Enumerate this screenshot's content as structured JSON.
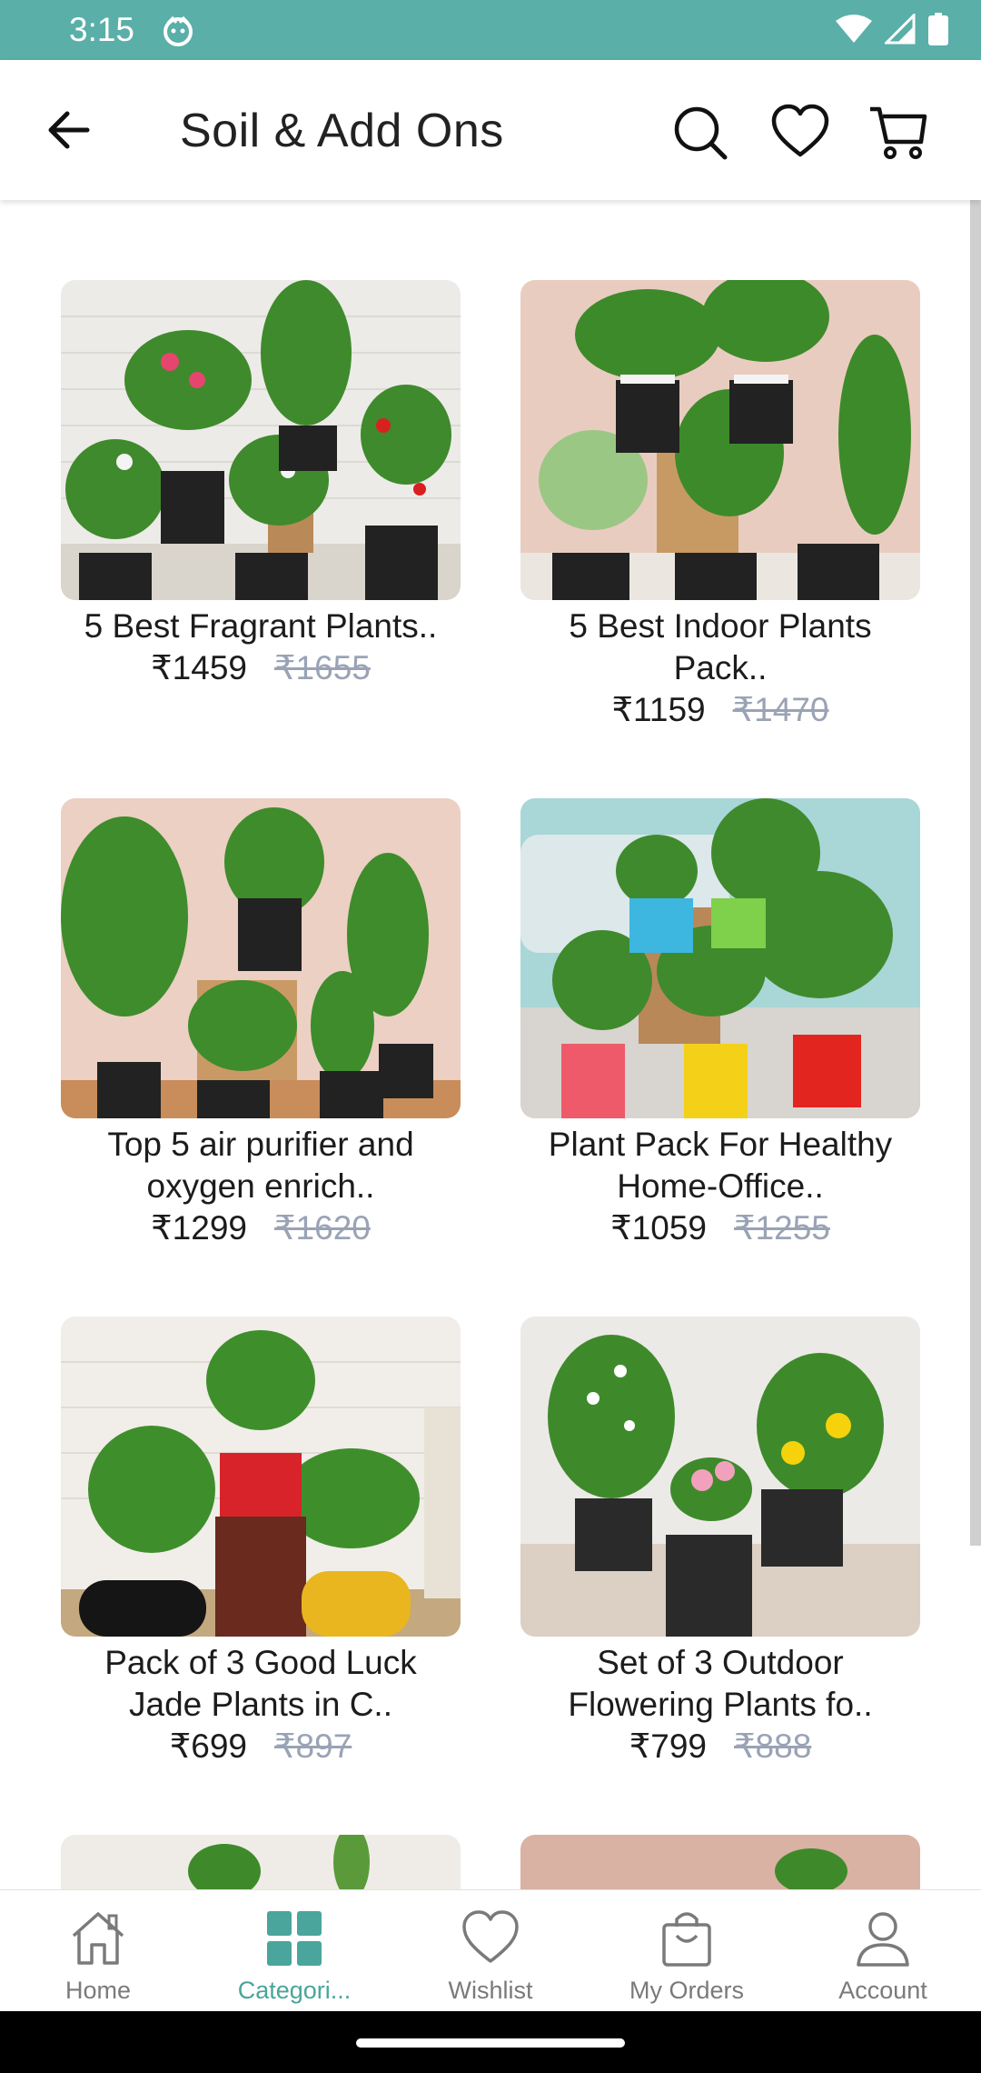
{
  "status_bar": {
    "time": "3:15"
  },
  "header": {
    "title": "Soil & Add Ons"
  },
  "products": [
    {
      "name": "5 Best Fragrant Plants..",
      "price": "₹1459",
      "mrp": "₹1655"
    },
    {
      "name": "5 Best Indoor Plants Pack..",
      "price": "₹1159",
      "mrp": "₹1470"
    },
    {
      "name": "Top 5 air purifier and oxygen enrich..",
      "price": "₹1299",
      "mrp": "₹1620"
    },
    {
      "name": "Plant Pack For Healthy Home-Office..",
      "price": "₹1059",
      "mrp": "₹1255"
    },
    {
      "name": "Pack of 3 Good Luck Jade Plants in C..",
      "price": "₹699",
      "mrp": "₹897"
    },
    {
      "name": "Set of 3 Outdoor Flowering Plants fo..",
      "price": "₹799",
      "mrp": "₹888"
    }
  ],
  "bottom_nav": [
    {
      "label": "Home",
      "icon": "home-icon",
      "active": false
    },
    {
      "label": "Categori...",
      "icon": "categories-icon",
      "active": true
    },
    {
      "label": "Wishlist",
      "icon": "heart-icon",
      "active": false
    },
    {
      "label": "My Orders",
      "icon": "shopping-bag-icon",
      "active": false
    },
    {
      "label": "Account",
      "icon": "user-icon",
      "active": false
    }
  ],
  "colors": {
    "accent": "#4aa59c",
    "status_bar": "#5aafa8",
    "mrp": "#9aa3b5"
  }
}
